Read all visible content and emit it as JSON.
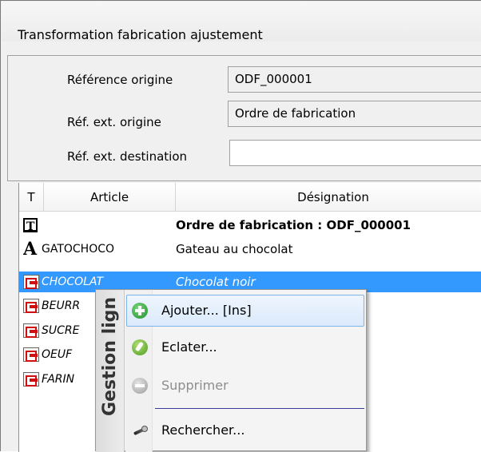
{
  "window": {
    "title": "Transformation fabrication ajustement"
  },
  "form": {
    "ref_origine_label": "Référence origine",
    "ref_origine_value": "ODF_000001",
    "ref_ext_origine_label": "Réf. ext. origine",
    "ref_ext_origine_value": "Ordre de fabrication",
    "ref_ext_dest_label": "Réf. ext. destination",
    "ref_ext_dest_value": ""
  },
  "grid": {
    "columns": {
      "type": "T",
      "article": "Article",
      "designation": "Désignation"
    },
    "rows": [
      {
        "icon": "title-row-icon",
        "article": "",
        "designation": "Ordre de fabrication : ODF_000001"
      },
      {
        "icon": "article-a-icon",
        "article": "GATOCHOCO",
        "designation": "Gateau au chocolat"
      },
      {
        "icon": "component-icon",
        "article": "CHOCOLAT",
        "designation": "Chocolat noir"
      },
      {
        "icon": "component-icon",
        "article": "BEURR",
        "designation": ""
      },
      {
        "icon": "component-icon",
        "article": "SUCRE",
        "designation": ""
      },
      {
        "icon": "component-icon",
        "article": "OEUF",
        "designation": ""
      },
      {
        "icon": "component-icon",
        "article": "FARIN",
        "designation": ""
      }
    ]
  },
  "context_menu": {
    "band_label": "Gestion lign",
    "items": [
      {
        "label": "Ajouter... [Ins]",
        "icon": "add-icon",
        "state": "hover"
      },
      {
        "label": "Eclater...",
        "icon": "split-icon",
        "state": "enabled"
      },
      {
        "label": "Supprimer",
        "icon": "remove-icon",
        "state": "disabled"
      },
      {
        "label": "Rechercher...",
        "icon": "search-icon",
        "state": "enabled"
      }
    ]
  },
  "colors": {
    "selection": "#3399ff",
    "menu_hover_border": "#7eb4ea",
    "component_icon_red": "#d01010"
  }
}
